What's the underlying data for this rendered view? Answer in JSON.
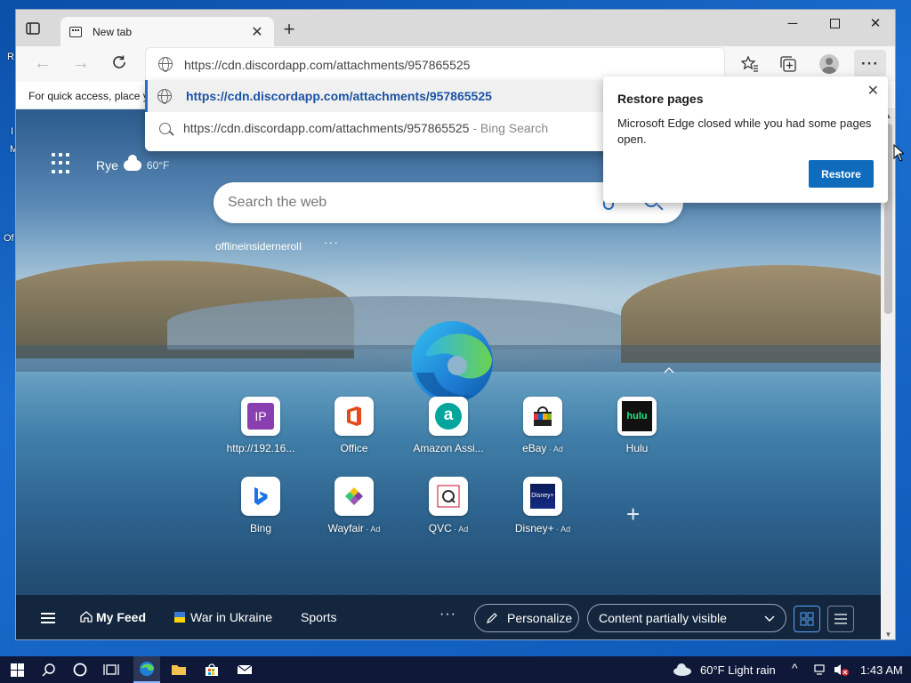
{
  "desktop": {
    "labels": [
      "R",
      "I",
      "M",
      "Of"
    ]
  },
  "browser": {
    "tab": {
      "title": "New tab"
    },
    "address": {
      "url": "https://cdn.discordapp.com/attachments/957865525"
    },
    "favorites_bar": {
      "text": "For quick access, place y"
    },
    "suggestions": [
      {
        "text": "https://cdn.discordapp.com/attachments/957865525",
        "hint": ""
      },
      {
        "text": "https://cdn.discordapp.com/attachments/957865525",
        "hint": " - Bing Search"
      }
    ]
  },
  "page": {
    "weather": {
      "city": "Rye",
      "temp": "60°F"
    },
    "search": {
      "placeholder": "Search the web"
    },
    "under_search": "offlineinsidernerolI",
    "tiles": [
      {
        "label": "http://192.16...",
        "ad": ""
      },
      {
        "label": "Office",
        "ad": ""
      },
      {
        "label": "Amazon Assi...",
        "ad": ""
      },
      {
        "label": "eBay",
        "ad": " · Ad"
      },
      {
        "label": "Hulu",
        "ad": ""
      },
      {
        "label": "Bing",
        "ad": ""
      },
      {
        "label": "Wayfair",
        "ad": " · Ad"
      },
      {
        "label": "QVC",
        "ad": " · Ad"
      },
      {
        "label": "Disney+",
        "ad": " · Ad"
      }
    ],
    "tile_glyphs": {
      "ip": "IP",
      "amazon": "a",
      "hulu": "hulu",
      "disney": "Disney+"
    },
    "feed": {
      "my_feed": "My Feed",
      "war": "War in Ukraine",
      "sports": "Sports",
      "personalize": "Personalize",
      "content": "Content partially visible"
    }
  },
  "popup": {
    "title": "Restore pages",
    "message": "Microsoft Edge closed while you had some pages open.",
    "button": "Restore"
  },
  "taskbar": {
    "weather": "60°F  Light rain",
    "time": "1:43 AM"
  },
  "colors": {
    "accent": "#0f6cbd",
    "taskbar": "#10183a",
    "desktop": "#0a4fa8"
  }
}
